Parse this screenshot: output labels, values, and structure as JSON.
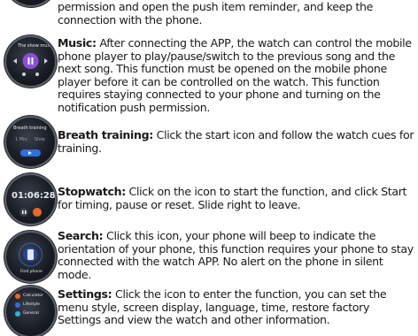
{
  "intro": {
    "line1": "permission and open the push item reminder, and keep the",
    "line2": "connection with the phone."
  },
  "sections": [
    {
      "title": "Music:",
      "text": "After connecting the APP, the watch can control the mobile phone player to play/pause/switch to the previous song and the next song. This function must be opened on the mobile phone player before it can be controlled on the watch. This function requires staying connected to your phone and turning on the notification push permission.",
      "watch_label": "The show must"
    },
    {
      "title": "Breath training:",
      "text": "Click the start icon and follow the watch cues for training.",
      "watch_label": "Breath training",
      "watch_sub1": "1 Min",
      "watch_sub2": "Slow"
    },
    {
      "title": "Stopwatch:",
      "text": "Click on the icon to start the function, and click Start for timing, pause or reset. Slide right to leave.",
      "watch_time": "01:06:28"
    },
    {
      "title": "Search:",
      "text": "Click this icon, your phone will beep to indicate the orientation of your phone, this function requires your phone to stay connected with the watch APP. No alert on the phone in silent mode.",
      "watch_label": "Find phone"
    },
    {
      "title": "Settings:",
      "text": "Click the icon to enter the function, you can set the menu style, screen display, language, time, restore factory Settings and view the watch and other information.",
      "watch_items": [
        "Calculator",
        "Lifestyle",
        "General"
      ]
    }
  ],
  "colors": {
    "accent_blue": "#2f6fe0",
    "accent_orange": "#e8672a",
    "accent_purple": "#8a4fd8",
    "text": "#1a1a1a"
  }
}
